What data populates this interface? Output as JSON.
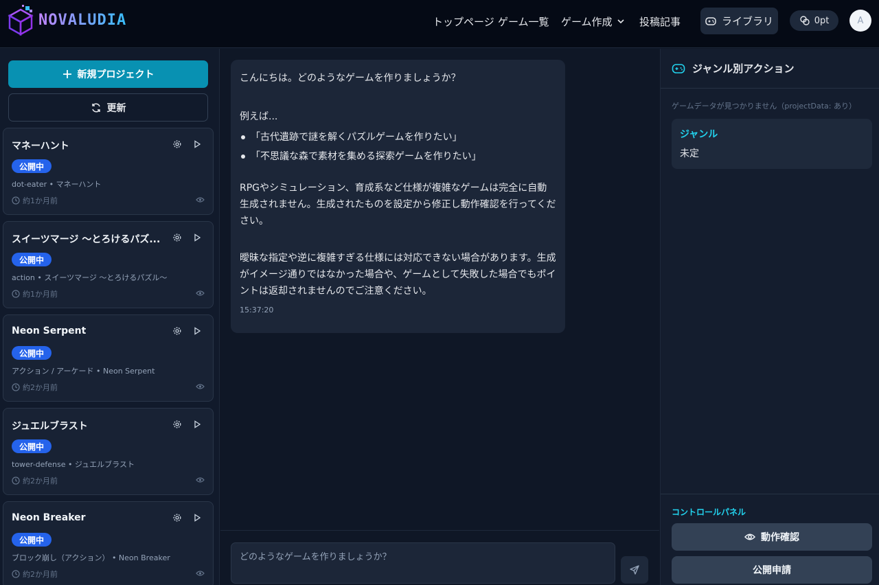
{
  "header": {
    "logo_text": "NOVALUDIA",
    "nav": [
      {
        "label": "トップページ"
      },
      {
        "label": "ゲーム一覧"
      },
      {
        "label": "ゲーム作成"
      },
      {
        "label": "投稿記事"
      }
    ],
    "library_label": "ライブラリ",
    "points_label": "0pt",
    "avatar_initial": "A"
  },
  "sidebar": {
    "new_project_label": "新規プロジェクト",
    "refresh_label": "更新",
    "projects": [
      {
        "title": "マネーハント",
        "status": "公開中",
        "subtitle": "dot-eater • マネーハント",
        "time": "約1か月前"
      },
      {
        "title": "スイーツマージ ～とろけるパズ...",
        "status": "公開中",
        "subtitle": "action • スイーツマージ ～とろけるパズル～",
        "time": "約1か月前"
      },
      {
        "title": "Neon Serpent",
        "status": "公開中",
        "subtitle": "アクション / アーケード • Neon Serpent",
        "time": "約2か月前"
      },
      {
        "title": "ジュエルブラスト",
        "status": "公開中",
        "subtitle": "tower-defense • ジュエルブラスト",
        "time": "約2か月前"
      },
      {
        "title": "Neon Breaker",
        "status": "公開中",
        "subtitle": "ブロック崩し（アクション） • Neon Breaker",
        "time": "約2か月前"
      }
    ]
  },
  "chat": {
    "message": {
      "greeting": "こんにちは。どのようなゲームを作りましょうか？",
      "example_intro": "例えば...",
      "examples": [
        "「古代遺跡で謎を解くパズルゲームを作りたい」",
        "「不思議な森で素材を集める探索ゲームを作りたい」"
      ],
      "note1": "RPGやシミュレーション、育成系など仕様が複雑なゲームは完全に自動生成されません。生成されたものを設定から修正し動作確認を行ってください。",
      "note2": "曖昧な指定や逆に複雑すぎる仕様には対応できない場合があります。生成がイメージ通りではなかった場合や、ゲームとして失敗した場合でもポイントは返却されませんのでご注意ください。",
      "timestamp": "15:37:20"
    },
    "input_placeholder": "どのようなゲームを作りましょうか？"
  },
  "right_panel": {
    "title": "ジャンル別アクション",
    "no_data": "ゲームデータが見つかりません（projectData: あり）",
    "genre_label": "ジャンル",
    "genre_value": "未定",
    "control_label": "コントロールパネル",
    "preview_label": "動作確認",
    "publish_label": "公開申請"
  },
  "colors": {
    "accent": "#0891b2",
    "badge": "#2563eb",
    "cyan_text": "#22d3ee"
  }
}
